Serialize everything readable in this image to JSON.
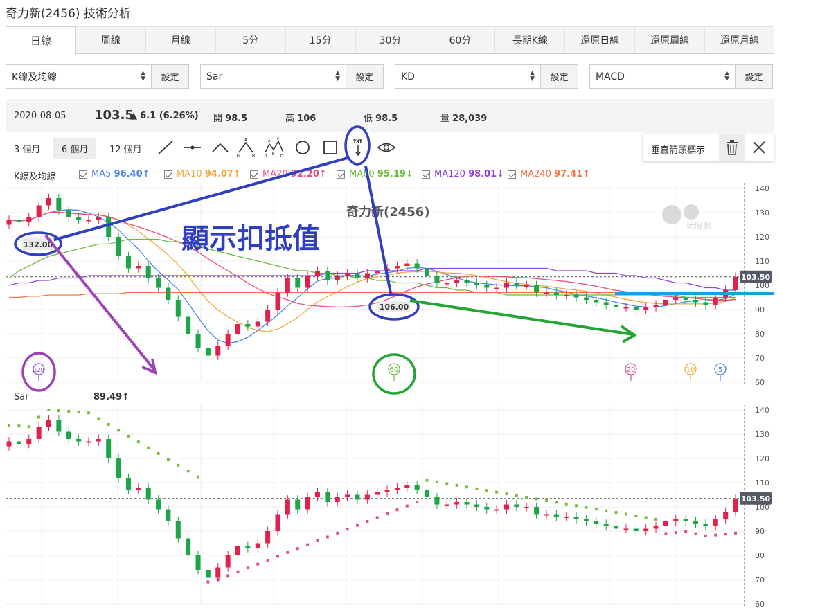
{
  "title": "奇力新(2456) 技術分析",
  "tabs": [
    "日線",
    "周線",
    "月線",
    "5分",
    "15分",
    "30分",
    "60分",
    "長期K線",
    "還原日線",
    "還原周線",
    "還原月線"
  ],
  "selectors": [
    {
      "value": "K線及均線",
      "button": "設定"
    },
    {
      "value": "Sar",
      "button": "設定"
    },
    {
      "value": "KD",
      "button": "設定"
    },
    {
      "value": "MACD",
      "button": "設定"
    }
  ],
  "info": {
    "date": "2020-08-05",
    "price": "103.5",
    "change": "6.1 (6.26%)",
    "open_label": "開",
    "open": "98.5",
    "high_label": "高",
    "high": "106",
    "low_label": "低",
    "low": "98.5",
    "volume_label": "量",
    "volume": "28,039"
  },
  "periods": [
    "3 個月",
    "6 個月",
    "12 個月"
  ],
  "tools": [
    "line-tool-icon",
    "horizontal-line-tool-icon",
    "angle-tool-icon",
    "abc-pattern-tool-icon",
    "wave-pattern-tool-icon",
    "circle-tool-icon",
    "rectangle-tool-icon",
    "text-arrow-tool-icon",
    "eye-icon"
  ],
  "popup": {
    "label": "垂直箭頭標示"
  },
  "legend": {
    "main": "K線及均線",
    "items": [
      {
        "name": "MA5",
        "value": "96.40↑",
        "color": "#4a86e8"
      },
      {
        "name": "MA10",
        "value": "94.07↑",
        "color": "#f6a93b"
      },
      {
        "name": "MA20",
        "value": "92.20↑",
        "color": "#ea4f7a"
      },
      {
        "name": "MA60",
        "value": "95.19↓",
        "color": "#6aba3b"
      },
      {
        "name": "MA120",
        "value": "98.01↓",
        "color": "#8e44d9"
      },
      {
        "name": "MA240",
        "value": "97.41↑",
        "color": "#f07448"
      }
    ]
  },
  "chart_main": {
    "stock_title": "奇力新(2456)",
    "watermark": "玩股網",
    "annotation": "顯示扣抵值",
    "y_ticks": [
      "140",
      "130",
      "120",
      "110",
      "100",
      "90",
      "80",
      "70",
      "60"
    ],
    "last_price_label": "103.50",
    "callouts": [
      "132.00",
      "106.00"
    ],
    "markers": [
      {
        "label": "120",
        "color": "#8e44d9"
      },
      {
        "label": "60",
        "color": "#6aba3b"
      },
      {
        "label": "20",
        "color": "#ea4f7a"
      },
      {
        "label": "10",
        "color": "#f6a93b"
      },
      {
        "label": "5",
        "color": "#4a86e8"
      }
    ]
  },
  "sar_panel": {
    "label": "Sar",
    "value": "89.49↑",
    "y_ticks": [
      "140",
      "130",
      "120",
      "110",
      "100",
      "90",
      "80",
      "70",
      "60"
    ],
    "last_price_label": "103.50"
  },
  "colors": {
    "up": "#e3204a",
    "down": "#1ea54a",
    "accent_blue": "#2f3fbf",
    "cyan": "#1a9fe0"
  }
}
